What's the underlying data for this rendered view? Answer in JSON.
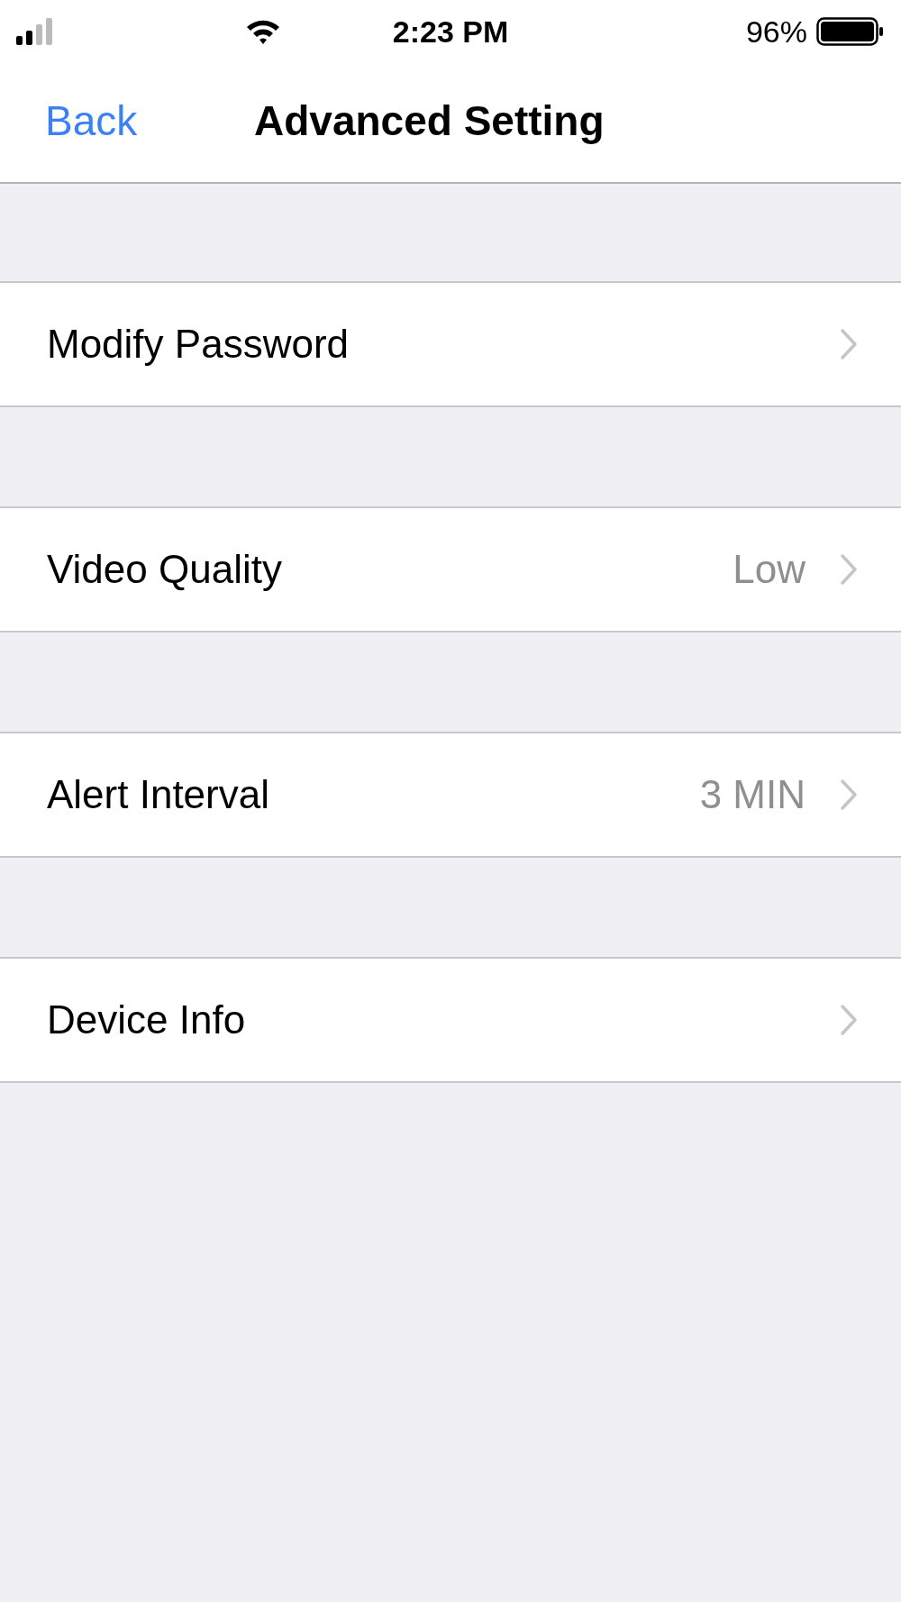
{
  "status_bar": {
    "time": "2:23 PM",
    "battery": "96%"
  },
  "nav_bar": {
    "back": "Back",
    "title": "Advanced Setting"
  },
  "rows": [
    {
      "label": "Modify Password"
    },
    {
      "label": "Video Quality",
      "value": "Low"
    },
    {
      "label": "Alert Interval",
      "value": "3 MIN"
    },
    {
      "label": "Device Info"
    }
  ]
}
